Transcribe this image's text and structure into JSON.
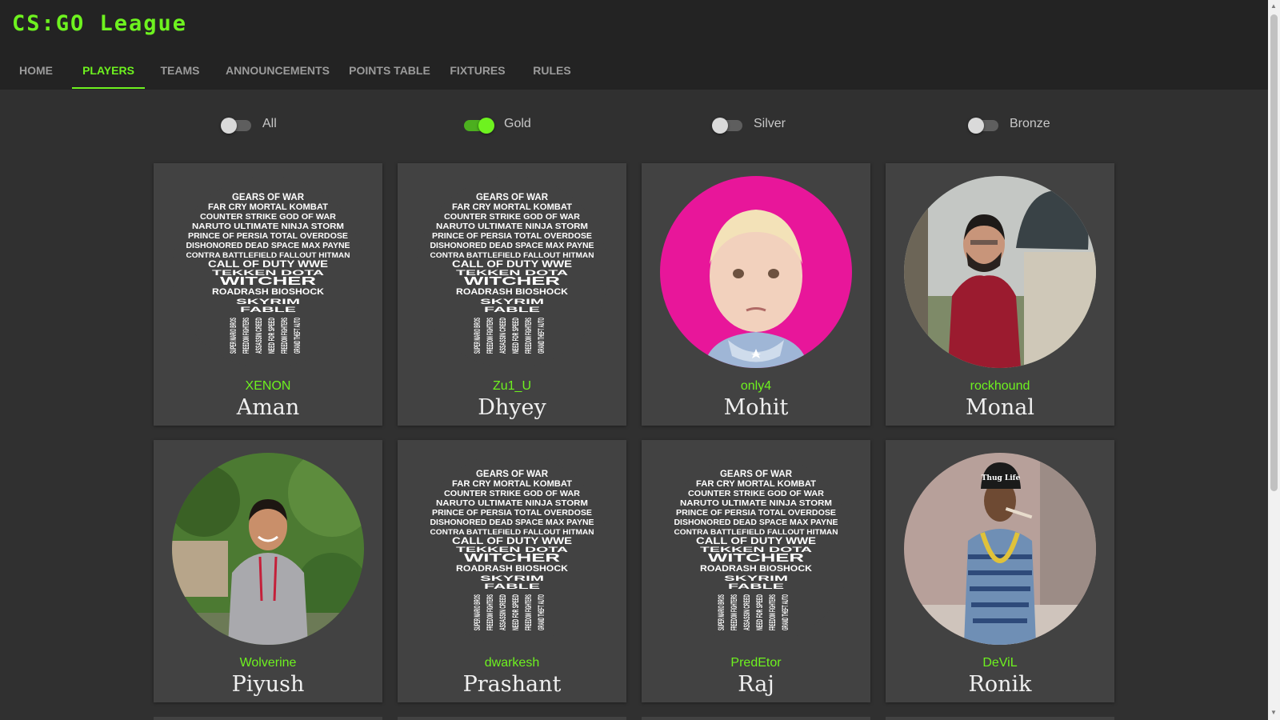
{
  "app": {
    "logo": "CS:GO League"
  },
  "nav": {
    "items": [
      {
        "label": "HOME"
      },
      {
        "label": "PLAYERS"
      },
      {
        "label": "TEAMS"
      },
      {
        "label": "ANNOUNCEMENTS"
      },
      {
        "label": "POINTS TABLE"
      },
      {
        "label": "FIXTURES"
      },
      {
        "label": "RULES"
      }
    ],
    "active": "PLAYERS"
  },
  "filters": [
    {
      "label": "All",
      "on": false
    },
    {
      "label": "Gold",
      "on": true
    },
    {
      "label": "Silver",
      "on": false
    },
    {
      "label": "Bronze",
      "on": false
    }
  ],
  "players": [
    {
      "handle": "XENON",
      "name": "Aman",
      "avatar": "game-titles-skull-avatar"
    },
    {
      "handle": "Zu1_U",
      "name": "Dhyey",
      "avatar": "game-titles-skull-avatar"
    },
    {
      "handle": "only4",
      "name": "Mohit",
      "avatar": "child-portrait-photo"
    },
    {
      "handle": "rockhound",
      "name": "Monal",
      "avatar": "man-with-lion-statue-photo"
    },
    {
      "handle": "Wolverine",
      "name": "Piyush",
      "avatar": "smiling-man-in-hoodie-photo"
    },
    {
      "handle": "dwarkesh",
      "name": "Prashant",
      "avatar": "game-titles-skull-avatar"
    },
    {
      "handle": "PredEtor",
      "name": "Raj",
      "avatar": "game-titles-skull-avatar"
    },
    {
      "handle": "DeViL",
      "name": "Ronik",
      "avatar": "thug-life-meme-photo"
    }
  ],
  "skull_text": {
    "lines": [
      "GEARS OF WAR",
      "FAR CRY MORTAL KOMBAT",
      "COUNTER STRIKE GOD OF WAR",
      "NARUTO ULTIMATE NINJA STORM",
      "PRINCE OF PERSIA TOTAL OVERDOSE",
      "DISHONORED DEAD SPACE MAX PAYNE",
      "CONTRA BATTLEFIELD FALLOUT HITMAN",
      "CALL OF DUTY WWE",
      "TEKKEN DOTA",
      "WITCHER",
      "ROADRASH BIOSHOCK",
      "SKYRIM",
      "FABLE"
    ],
    "columns": [
      "SUPER MARIO BROS",
      "FREEDOM FIGHTERS",
      "ASSASSIN CREED",
      "NEED FOR SPEED",
      "FREEDOM FIGHTERS",
      "GRAND THEFT AUTO"
    ]
  },
  "photo_badges": {
    "thug_life_cap": "Thug Life"
  },
  "colors": {
    "accent": "#6ef21f",
    "card": "#424242",
    "background": "#303030",
    "header": "#232323"
  }
}
